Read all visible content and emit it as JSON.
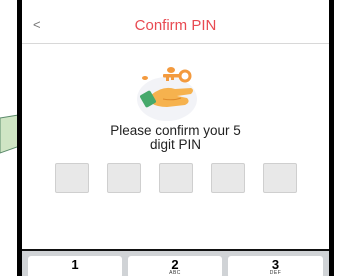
{
  "header": {
    "back_label": "<",
    "title": "Confirm PIN"
  },
  "prompt": {
    "line1": "Please confirm your 5",
    "line2": "digit PIN"
  },
  "pin": {
    "length": 5
  },
  "keypad": [
    {
      "number": "1",
      "letters": ""
    },
    {
      "number": "2",
      "letters": "ABC"
    },
    {
      "number": "3",
      "letters": "DEF"
    }
  ],
  "colors": {
    "accent": "#e84a52",
    "callout_fill": "#cfe5c4",
    "callout_stroke": "#5a8a6a"
  }
}
